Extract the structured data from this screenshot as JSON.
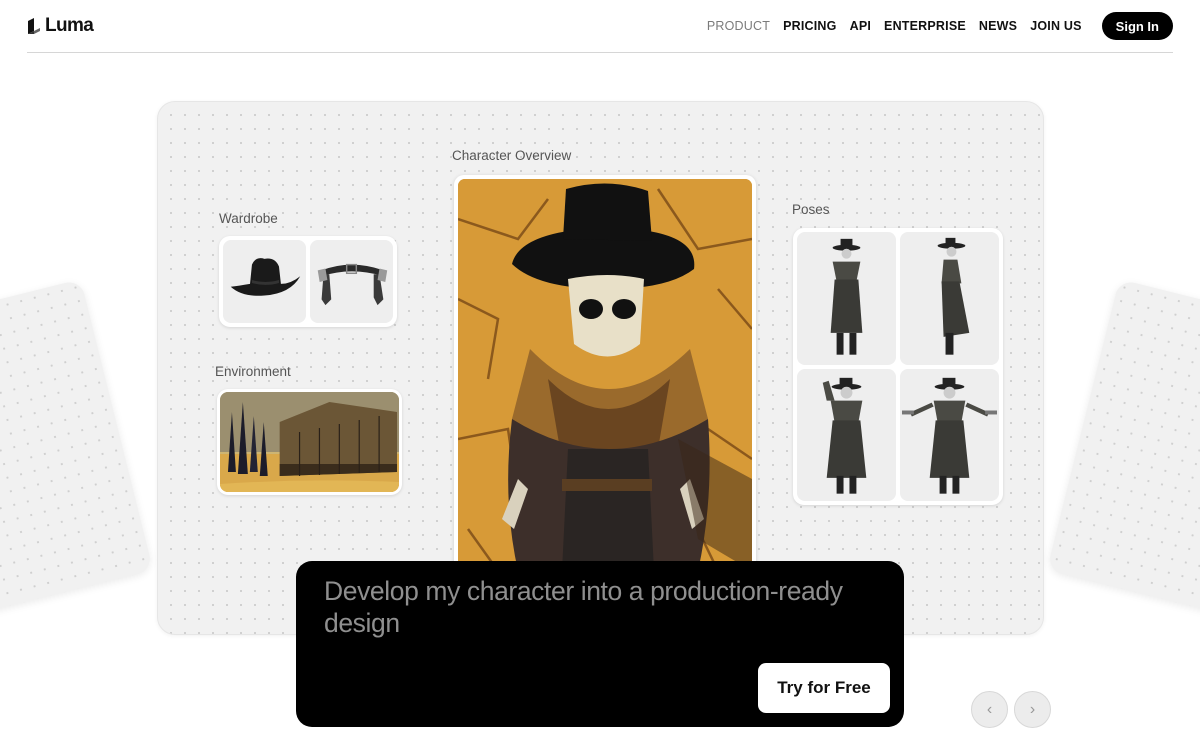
{
  "header": {
    "logo_text": "Luma",
    "nav": [
      {
        "label": "PRODUCT",
        "active": true
      },
      {
        "label": "PRICING",
        "active": false
      },
      {
        "label": "API",
        "active": false
      },
      {
        "label": "ENTERPRISE",
        "active": false
      },
      {
        "label": "NEWS",
        "active": false
      },
      {
        "label": "JOIN US",
        "active": false
      }
    ],
    "signin_label": "Sign In"
  },
  "board": {
    "wardrobe_label": "Wardrobe",
    "environment_label": "Environment",
    "overview_label": "Character Overview",
    "poses_label": "Poses"
  },
  "prompt": {
    "text": "Develop my character into a production-ready design",
    "button_label": "Try for Free"
  },
  "carousel": {
    "prev_icon": "‹",
    "next_icon": "›"
  },
  "colors": {
    "accent": "#000000",
    "board_bg": "#f1f1f1",
    "nav_active": "#7b7b7b"
  }
}
